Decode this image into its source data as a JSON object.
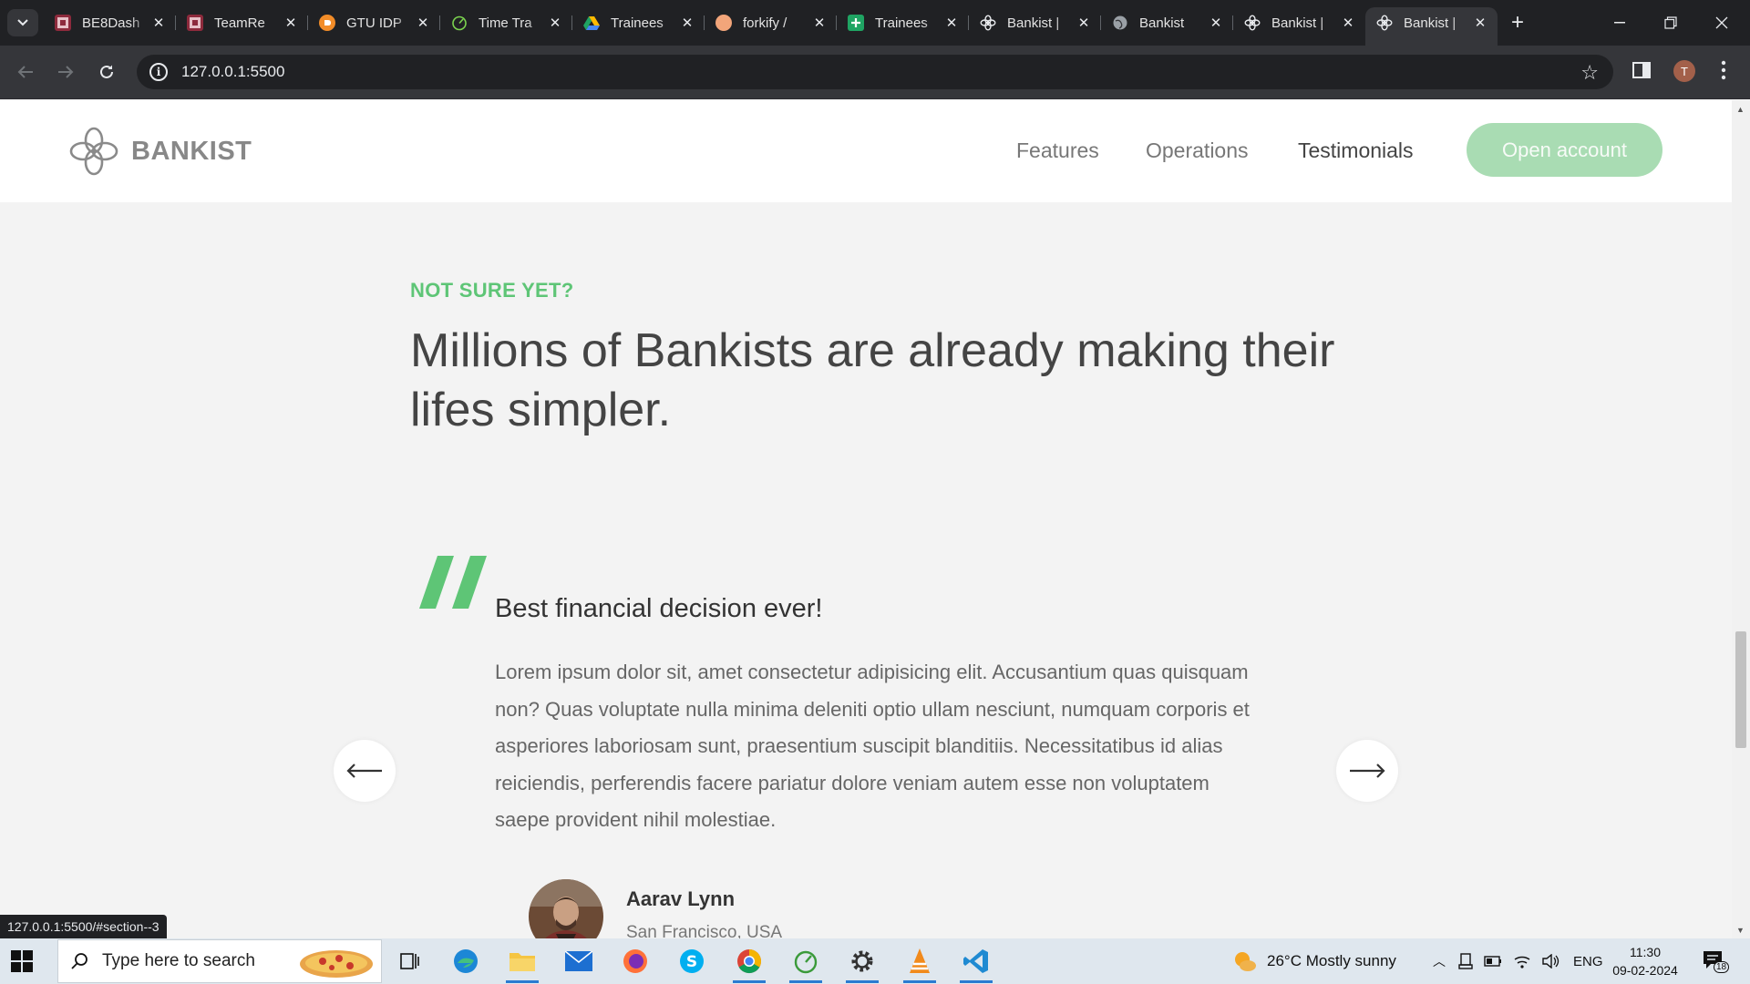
{
  "browser": {
    "tabs": [
      {
        "title": "BE8Dash",
        "favicon": "app-icon",
        "color": "#8d2a3c"
      },
      {
        "title": "TeamRe",
        "favicon": "app-icon",
        "color": "#8d2a3c"
      },
      {
        "title": "GTU IDP",
        "favicon": "circle-icon",
        "color": "#f28c28"
      },
      {
        "title": "Time Tra",
        "favicon": "clock-icon",
        "color": "#7bd34f"
      },
      {
        "title": "Trainees",
        "favicon": "drive-icon",
        "color": "#1fa463"
      },
      {
        "title": "forkify /",
        "favicon": "pizza-icon",
        "color": "#f2a57a"
      },
      {
        "title": "Trainees",
        "favicon": "sheets-icon",
        "color": "#1fa463"
      },
      {
        "title": "Bankist |",
        "favicon": "bankist-icon",
        "color": "#e8eaed"
      },
      {
        "title": "Bankist",
        "favicon": "globe-icon",
        "color": "#9aa0a6"
      },
      {
        "title": "Bankist |",
        "favicon": "bankist-icon",
        "color": "#e8eaed"
      },
      {
        "title": "Bankist |",
        "favicon": "bankist-icon",
        "color": "#e8eaed",
        "active": true
      }
    ],
    "url": "127.0.0.1:5500",
    "profile_initial": "T",
    "status_url": "127.0.0.1:5500/#section--3"
  },
  "site": {
    "logo_text": "BANKIST",
    "nav": {
      "features": "Features",
      "operations": "Operations",
      "testimonials": "Testimonials",
      "open_account": "Open account"
    },
    "accent": "#5ec576"
  },
  "section": {
    "label": "NOT SURE YET?",
    "title": "Millions of Bankists are already making their lifes simpler."
  },
  "testimonial": {
    "header": "Best financial decision ever!",
    "body": "Lorem ipsum dolor sit, amet consectetur adipisicing elit. Accusantium quas quisquam non? Quas voluptate nulla minima deleniti optio ullam nesciunt, numquam corporis et asperiores laboriosam sunt, praesentium suscipit blanditiis. Necessitatibus id alias reiciendis, perferendis facere pariatur dolore veniam autem esse non voluptatem saepe provident nihil molestiae.",
    "author_name": "Aarav Lynn",
    "author_location": "San Francisco, USA"
  },
  "taskbar": {
    "search_placeholder": "Type here to search",
    "weather": "26°C  Mostly sunny",
    "language": "ENG",
    "time": "11:30",
    "date": "09-02-2024",
    "notification_count": "18"
  }
}
